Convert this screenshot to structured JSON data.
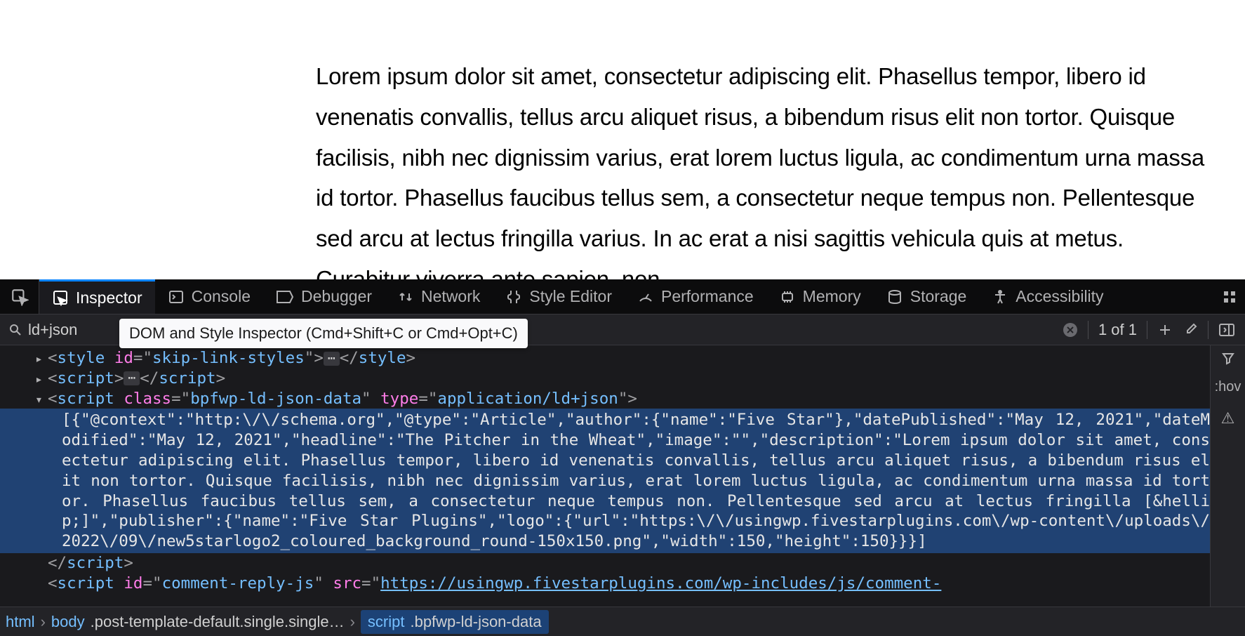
{
  "page": {
    "article_text": "Lorem ipsum dolor sit amet, consectetur adipiscing elit. Phasellus tempor, libero id venenatis convallis, tellus arcu aliquet risus, a bibendum risus elit non tortor. Quisque facilisis, nibh nec dignissim varius, erat lorem luctus ligula, ac condimentum urna massa id tortor. Phasellus faucibus tellus sem, a consectetur neque tempus non. Pellentesque sed arcu at lectus fringilla varius. In ac erat a nisi sagittis vehicula quis at metus. Curabitur viverra ante sapien, non"
  },
  "devtools": {
    "tabs": {
      "inspector": "Inspector",
      "console": "Console",
      "debugger": "Debugger",
      "network": "Network",
      "style_editor": "Style Editor",
      "performance": "Performance",
      "memory": "Memory",
      "storage": "Storage",
      "accessibility": "Accessibility"
    },
    "tooltip": "DOM and Style Inspector (Cmd+Shift+C or Cmd+Opt+C)",
    "search": {
      "value": "ld+json",
      "result": "1 of 1"
    },
    "markup": {
      "line_style_id": "skip-link-styles",
      "script_class": "bpfwp-ld-json-data",
      "script_type": "application/ld+json",
      "json_text": "[{\"@context\":\"http:\\/\\/schema.org\",\"@type\":\"Article\",\"author\":{\"name\":\"Five Star\"},\"datePublished\":\"May 12, 2021\",\"dateModified\":\"May 12, 2021\",\"headline\":\"The Pitcher in the Wheat\",\"image\":\"\",\"description\":\"Lorem ipsum dolor sit amet, consectetur adipiscing elit. Phasellus tempor, libero id venenatis convallis, tellus arcu aliquet risus, a bibendum risus elit non tortor. Quisque facilisis, nibh nec dignissim varius, erat lorem luctus ligula, ac condimentum urna massa id tortor. Phasellus faucibus tellus sem, a consectetur neque tempus non. Pellentesque sed arcu at lectus fringilla [&hellip;]\",\"publisher\":{\"name\":\"Five Star Plugins\",\"logo\":{\"url\":\"https:\\/\\/usingwp.fivestarplugins.com\\/wp-content\\/uploads\\/2022\\/09\\/new5starlogo2_coloured_background_round-150x150.png\",\"width\":150,\"height\":150}}}]",
      "comment_script_id": "comment-reply-js",
      "comment_script_src": "https://usingwp.fivestarplugins.com/wp-includes/js/comment-"
    },
    "side": {
      "hov": ":hov"
    },
    "breadcrumb": {
      "c1_tag": "html",
      "c2_tag": "body",
      "c2_cls": ".post-template-default.single.single…",
      "c3_tag": "script",
      "c3_cls": ".bpfwp-ld-json-data"
    }
  }
}
